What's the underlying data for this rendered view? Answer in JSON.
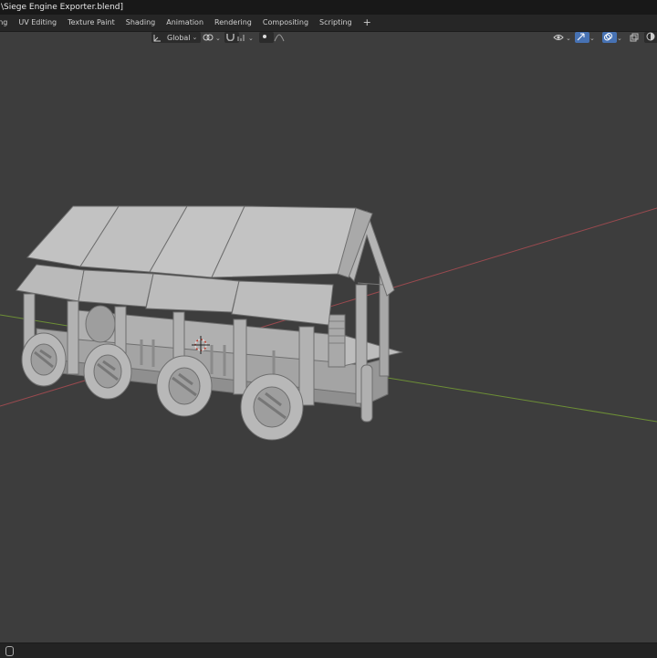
{
  "window": {
    "title": "\\Siege Engine Exporter.blend]"
  },
  "workspaces": {
    "tabs": [
      "ing",
      "UV Editing",
      "Texture Paint",
      "Shading",
      "Animation",
      "Rendering",
      "Compositing",
      "Scripting"
    ],
    "add_label": "+"
  },
  "header": {
    "transform_orientation": "Global",
    "icons": [
      "orientation-axes-icon",
      "pivot-link-icon",
      "snap-magnet-icon",
      "snap-increment-icon",
      "proportional-dot-icon",
      "falloff-curve-icon",
      "visibility-eye-icon",
      "gizmo-icon",
      "overlay-icon",
      "xray-icon",
      "shading-solid-icon"
    ]
  },
  "viewport": {
    "object": "Siege engine mesh",
    "colors": {
      "background": "#3d3d3d",
      "x_axis": "#9a4a4f",
      "y_axis": "#6d8f36",
      "mesh": "#a8a8a8"
    }
  }
}
